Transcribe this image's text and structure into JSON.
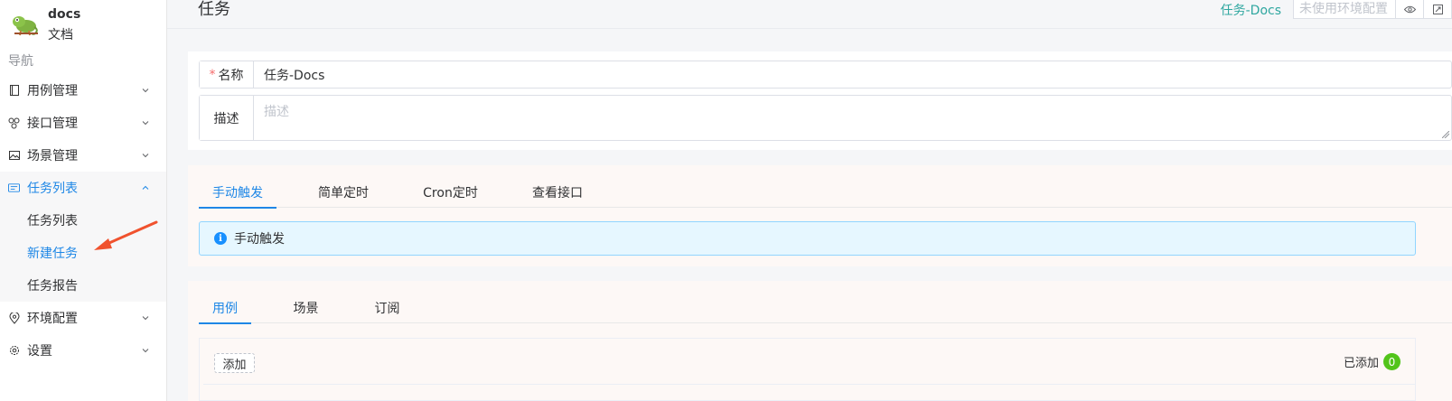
{
  "brand": {
    "name": "docs",
    "subtitle": "文档"
  },
  "sidebar": {
    "nav_title": "导航",
    "items": [
      {
        "label": "用例管理",
        "icon": "book-icon"
      },
      {
        "label": "接口管理",
        "icon": "api-icon"
      },
      {
        "label": "场景管理",
        "icon": "image-icon"
      },
      {
        "label": "任务列表",
        "icon": "task-icon",
        "expanded": true
      },
      {
        "label": "环境配置",
        "icon": "location-icon"
      },
      {
        "label": "设置",
        "icon": "gear-icon"
      }
    ],
    "sub_items": [
      {
        "label": "任务列表"
      },
      {
        "label": "新建任务",
        "active": true
      },
      {
        "label": "任务报告"
      }
    ]
  },
  "header": {
    "title": "任务",
    "task_link": "任务-Docs",
    "env_placeholder": "未使用环境配置"
  },
  "form": {
    "name_label": "名称",
    "name_value": "任务-Docs",
    "desc_label": "描述",
    "desc_placeholder": "描述"
  },
  "trigger_tabs": [
    {
      "label": "手动触发",
      "active": true
    },
    {
      "label": "简单定时"
    },
    {
      "label": "Cron定时"
    },
    {
      "label": "查看接口"
    }
  ],
  "trigger_info": "手动触发",
  "content_tabs": [
    {
      "label": "用例",
      "active": true
    },
    {
      "label": "场景"
    },
    {
      "label": "订阅"
    }
  ],
  "list": {
    "add_label": "添加",
    "added_label": "已添加",
    "added_count": "0"
  },
  "colors": {
    "accent": "#1e87e6",
    "teal": "#2fa7a0",
    "success": "#52c41a",
    "arrow": "#f0522e"
  }
}
